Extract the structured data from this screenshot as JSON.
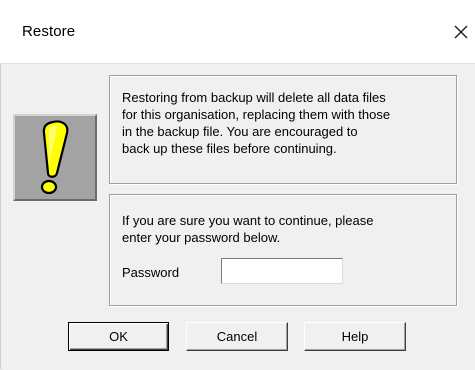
{
  "window": {
    "title": "Restore",
    "close_glyph": "close-icon"
  },
  "icon": {
    "name": "exclamation-icon",
    "colors": {
      "fill": "#ffff00",
      "outline": "#000000",
      "background": "#a3a3a3"
    }
  },
  "warning": {
    "text": "Restoring from backup will delete all data files\nfor this organisation, replacing them with those\nin the backup file. You are encouraged to\nback up these files before continuing."
  },
  "confirm": {
    "text": "If you are sure you want to continue, please\nenter your password below.",
    "password_label": "Password",
    "password_value": ""
  },
  "buttons": {
    "ok": "OK",
    "cancel": "Cancel",
    "help": "Help"
  }
}
